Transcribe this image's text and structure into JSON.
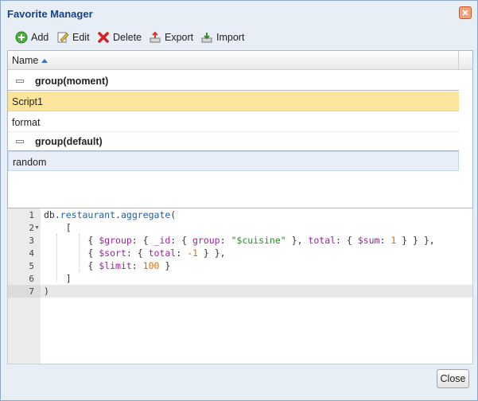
{
  "window": {
    "title": "Favorite Manager"
  },
  "toolbar": {
    "add_label": "Add",
    "edit_label": "Edit",
    "delete_label": "Delete",
    "export_label": "Export",
    "import_label": "Import"
  },
  "grid": {
    "column_header": "Name",
    "groups": [
      {
        "label": "group(moment)",
        "items": [
          "Script1",
          "format"
        ]
      },
      {
        "label": "group(default)",
        "items": [
          "random"
        ]
      }
    ]
  },
  "editor": {
    "line_numbers": [
      "1",
      "2",
      "3",
      "4",
      "5",
      "6",
      "7"
    ]
  },
  "footer": {
    "close_label": "Close"
  },
  "colors": {
    "title": "#15428b",
    "selected_row": "#fbe49b",
    "function": "#1f5fa8",
    "operator": "#a020a0",
    "string": "#2a8a2a",
    "number": "#e66a00"
  },
  "icons": [
    "close-icon",
    "add-icon",
    "edit-icon",
    "delete-icon",
    "export-icon",
    "import-icon",
    "sort-ascending-icon",
    "collapse-icon",
    "fold-arrow-icon"
  ]
}
